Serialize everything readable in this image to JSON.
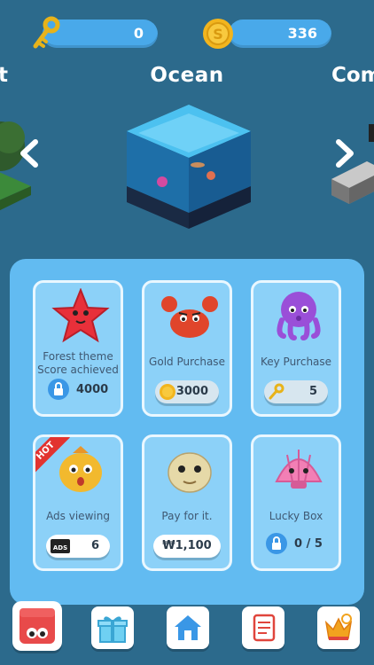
{
  "currency": {
    "keys": "0",
    "gold": "336"
  },
  "theme": {
    "prev_label": "t",
    "title": "Ocean",
    "next_label": "Com"
  },
  "cards": [
    {
      "label": "Forest theme\nScore achieved",
      "value": "4000",
      "type": "locked"
    },
    {
      "label": "Gold Purchase",
      "value": "3000",
      "type": "gold"
    },
    {
      "label": "Key Purchase",
      "value": "5",
      "type": "key"
    },
    {
      "label": "Ads viewing",
      "value": "6",
      "type": "ads",
      "badge": "HOT"
    },
    {
      "label": "Pay for it.",
      "value": "₩1,100",
      "type": "price"
    },
    {
      "label": "Lucky Box",
      "value": "0 / 5",
      "type": "locked"
    }
  ],
  "ads_label": "ADS",
  "nav": [
    "character",
    "gift",
    "home",
    "quest",
    "ranking"
  ],
  "colors": {
    "background": "#2c6a8c",
    "panel": "#62bbf1",
    "card": "#8cd1f8",
    "bar": "#49a9ea"
  }
}
